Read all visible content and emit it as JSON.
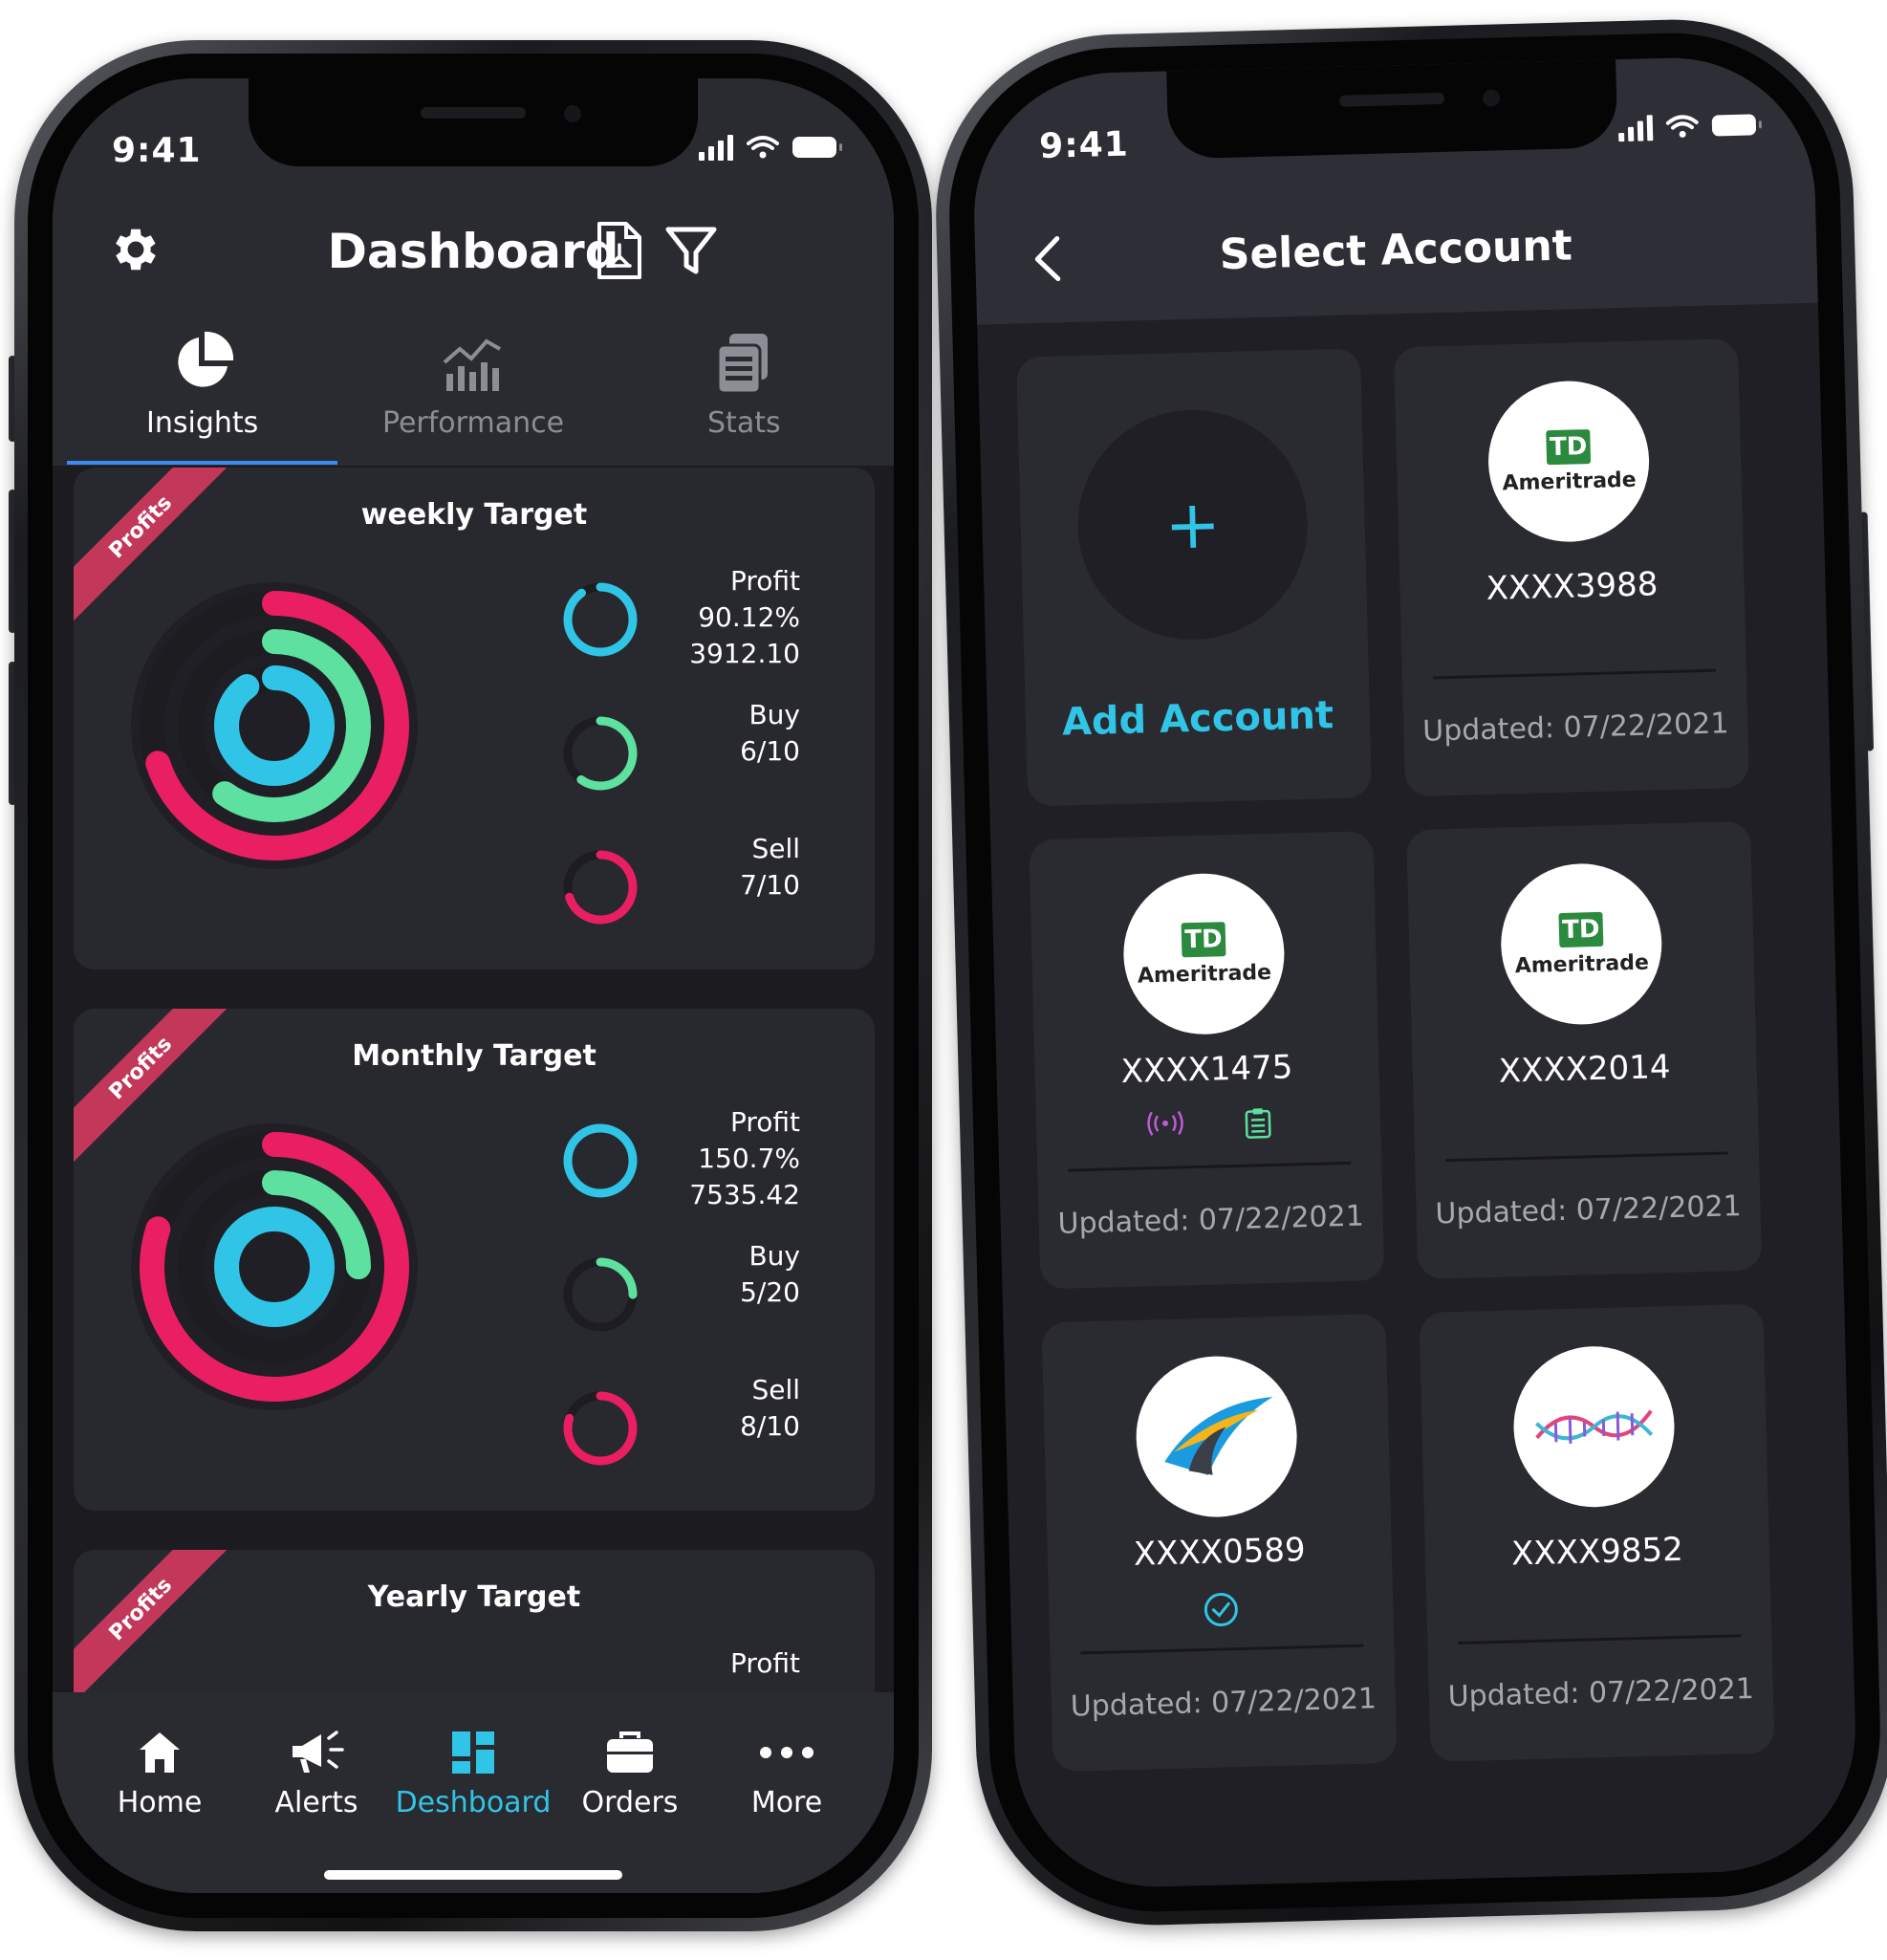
{
  "left": {
    "status_time": "9:41",
    "title": "Dashboard",
    "tabs": [
      {
        "label": "Insights",
        "icon": "pie-chart-icon",
        "active": true
      },
      {
        "label": "Performance",
        "icon": "bar-chart-icon",
        "active": false
      },
      {
        "label": "Stats",
        "icon": "stats-icon",
        "active": false
      }
    ],
    "cards": [
      {
        "ribbon": "Profits",
        "title": "weekly Target",
        "profit_label": "Profit",
        "profit_pct": "90.12%",
        "profit_value": "3912.10",
        "buy_label": "Buy",
        "buy_value": "6/10",
        "sell_label": "Sell",
        "sell_value": "7/10",
        "rings": {
          "profit": 0.9012,
          "buy": 0.6,
          "sell": 0.7
        }
      },
      {
        "ribbon": "Profits",
        "title": "Monthly Target",
        "profit_label": "Profit",
        "profit_pct": "150.7%",
        "profit_value": "7535.42",
        "buy_label": "Buy",
        "buy_value": "5/20",
        "sell_label": "Sell",
        "sell_value": "8/10",
        "rings": {
          "profit": 1.0,
          "buy": 0.25,
          "sell": 0.8
        }
      },
      {
        "ribbon": "Profits",
        "title": "Yearly Target",
        "profit_label": "Profit"
      }
    ],
    "nav": [
      {
        "label": "Home",
        "icon": "home-icon",
        "active": false
      },
      {
        "label": "Alerts",
        "icon": "megaphone-icon",
        "active": false
      },
      {
        "label": "Deshboard",
        "icon": "dashboard-icon",
        "active": true
      },
      {
        "label": "Orders",
        "icon": "briefcase-icon",
        "active": false
      },
      {
        "label": "More",
        "icon": "more-dots-icon",
        "active": false
      }
    ],
    "colors": {
      "profit": "#30c5e6",
      "buy": "#5de0a0",
      "sell": "#e91e63",
      "track": "#1c1c21"
    }
  },
  "right": {
    "status_time": "9:41",
    "title": "Select Account",
    "add_account_label": "Add Account",
    "accounts": [
      {
        "number": "XXXX3988",
        "logo": "TD Ameritrade",
        "updated": "Updated: 07/22/2021"
      },
      {
        "number": "XXXX1475",
        "logo": "TD Ameritrade",
        "updated": "Updated: 07/22/2021",
        "badges": [
          "broadcast-icon",
          "clipboard-icon"
        ]
      },
      {
        "number": "XXXX2014",
        "logo": "TD Ameritrade",
        "updated": "Updated: 07/22/2021"
      },
      {
        "number": "XXXX0589",
        "logo": "arrow-logo",
        "updated": "Updated: 07/22/2021",
        "badges": [
          "check-circle-icon"
        ]
      },
      {
        "number": "XXXX9852",
        "logo": "nano-mrna-logo",
        "updated": "Updated: 07/22/2021"
      }
    ],
    "td_box": "TD",
    "td_name": "Ameritrade"
  }
}
